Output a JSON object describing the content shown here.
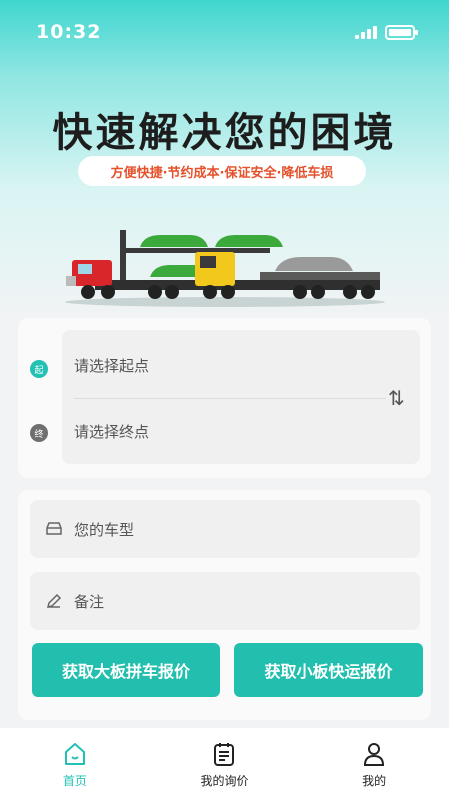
{
  "status": {
    "time": "10:32"
  },
  "hero": {
    "headline": "快速解决您的困境",
    "slogan": "方便快捷·节约成本·保证安全·降低车损"
  },
  "route": {
    "start_marker": "起",
    "end_marker": "终",
    "start_placeholder": "请选择起点",
    "end_placeholder": "请选择终点",
    "swap_icon": "swap-vertical-icon"
  },
  "form": {
    "vehicle_placeholder": "您的车型",
    "remark_placeholder": "备注",
    "vehicle_icon": "car-icon",
    "remark_icon": "pencil-icon"
  },
  "actions": {
    "large_board_quote": "获取大板拼车报价",
    "small_board_quote": "获取小板快运报价"
  },
  "tabbar": {
    "items": [
      {
        "label": "首页",
        "icon": "home-icon",
        "active": true
      },
      {
        "label": "我的询价",
        "icon": "clipboard-icon",
        "active": false
      },
      {
        "label": "我的",
        "icon": "user-icon",
        "active": false
      }
    ]
  },
  "colors": {
    "accent": "#23bfae",
    "slogan_text": "#e4512b",
    "end_marker": "#6f6f6f"
  }
}
